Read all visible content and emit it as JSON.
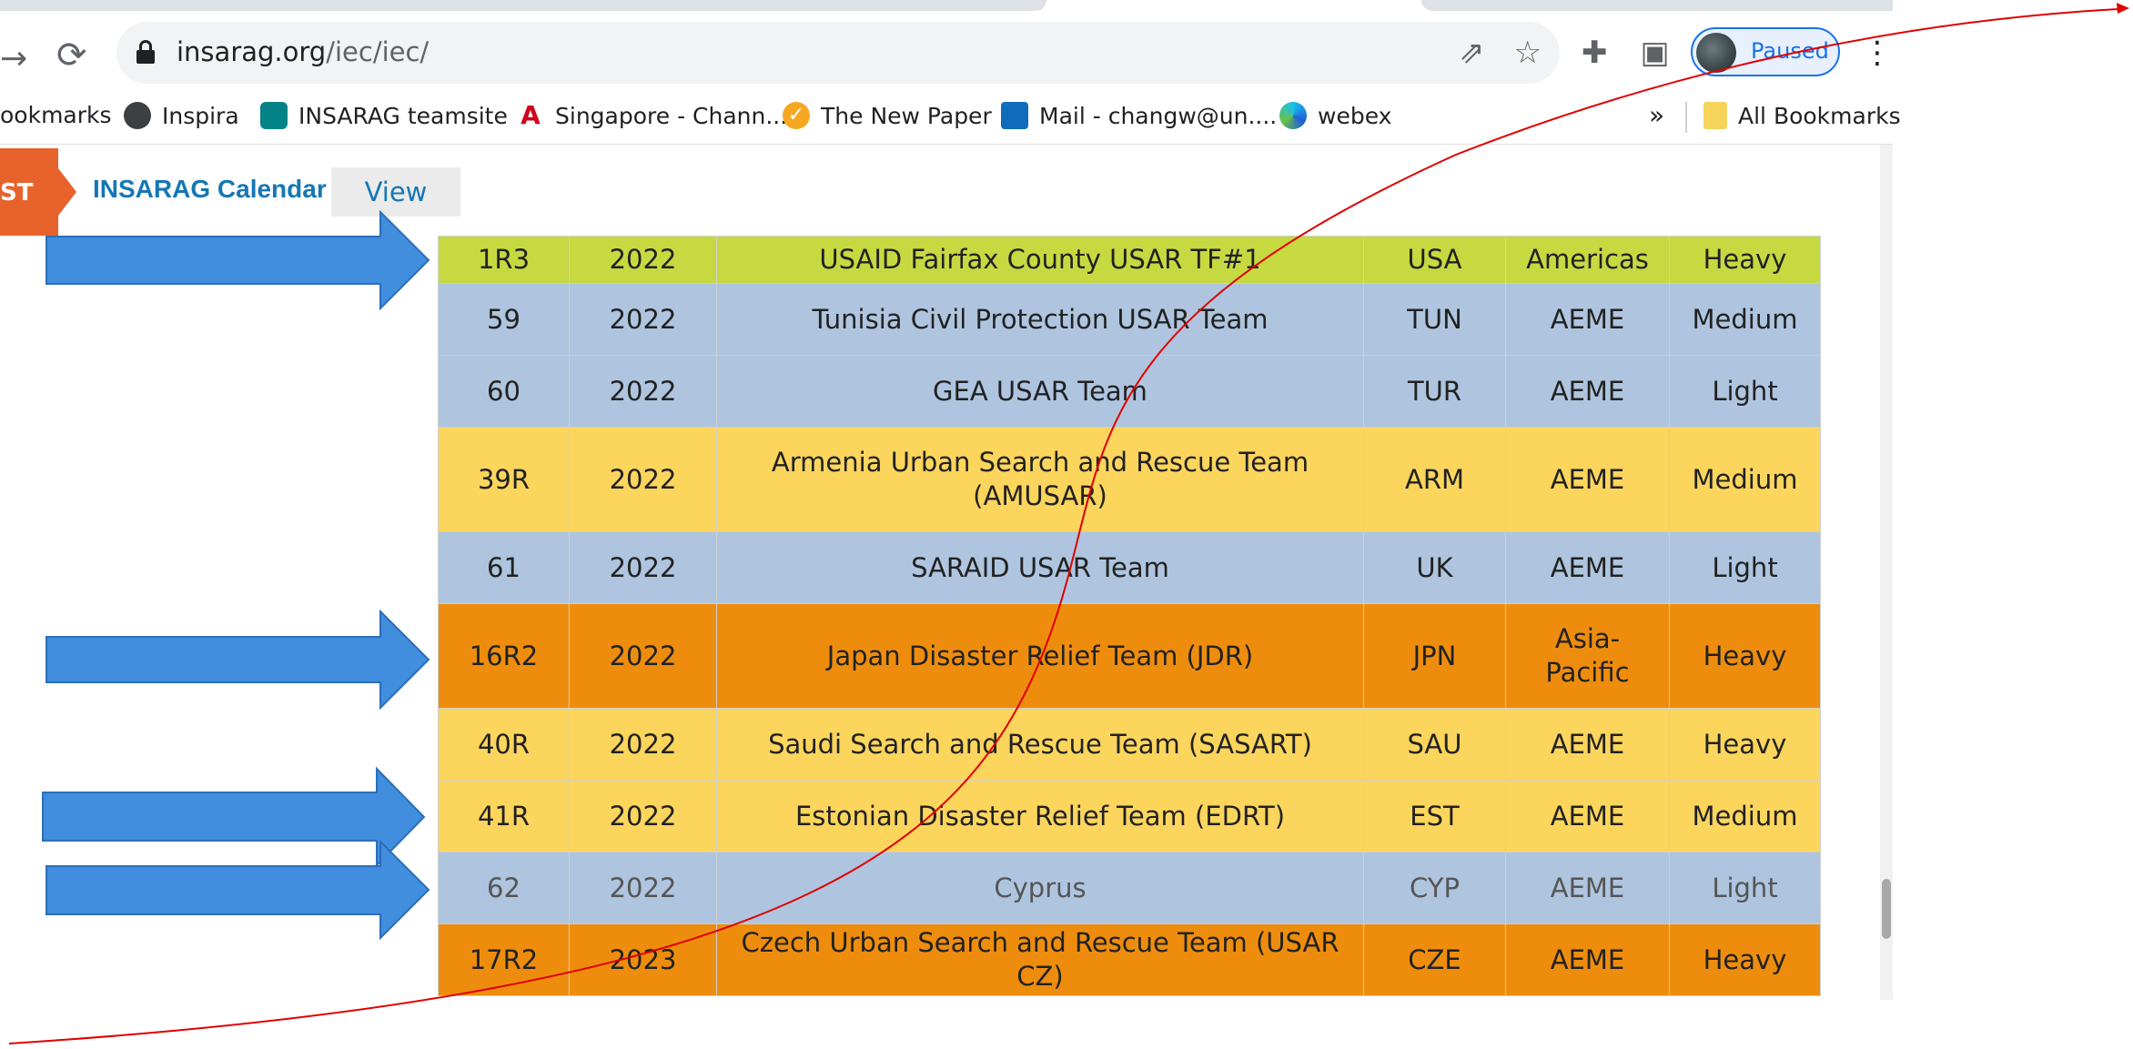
{
  "browser": {
    "url_host": "insarag.org",
    "url_path": "/iec/iec/",
    "profile_status": "Paused",
    "icons": [
      "forward-icon",
      "reload-icon",
      "lock-icon",
      "share-icon",
      "star-icon",
      "extensions-icon",
      "side-panel-icon",
      "menu-icon"
    ]
  },
  "bookmarks": {
    "items": [
      {
        "label": "ookmarks"
      },
      {
        "label": "Inspira"
      },
      {
        "label": "INSARAG teamsite"
      },
      {
        "label": "Singapore - Chann..."
      },
      {
        "label": "The New Paper"
      },
      {
        "label": "Mail - changw@un...."
      },
      {
        "label": "webex"
      }
    ],
    "more": "»",
    "all_bookmarks": "All Bookmarks"
  },
  "page": {
    "tag": "ST",
    "calendar_title": "INSARAG Calendar",
    "view_label": "View"
  },
  "table": {
    "rows": [
      {
        "id": "1R3",
        "year": "2022",
        "team": "USAID Fairfax County USAR TF#1",
        "country": "USA",
        "region": "Americas",
        "level": "Heavy",
        "color": "green"
      },
      {
        "id": "59",
        "year": "2022",
        "team": "Tunisia Civil Protection USAR Team",
        "country": "TUN",
        "region": "AEME",
        "level": "Medium",
        "color": "blue"
      },
      {
        "id": "60",
        "year": "2022",
        "team": "GEA USAR Team",
        "country": "TUR",
        "region": "AEME",
        "level": "Light",
        "color": "blue"
      },
      {
        "id": "39R",
        "year": "2022",
        "team": "Armenia Urban Search and Rescue Team (AMUSAR)",
        "country": "ARM",
        "region": "AEME",
        "level": "Medium",
        "color": "yellow"
      },
      {
        "id": "61",
        "year": "2022",
        "team": "SARAID USAR Team",
        "country": "UK",
        "region": "AEME",
        "level": "Light",
        "color": "blue"
      },
      {
        "id": "16R2",
        "year": "2022",
        "team": "Japan Disaster Relief Team (JDR)",
        "country": "JPN",
        "region": "Asia-Pacific",
        "level": "Heavy",
        "color": "orange"
      },
      {
        "id": "40R",
        "year": "2022",
        "team": "Saudi Search and Rescue Team (SASART)",
        "country": "SAU",
        "region": "AEME",
        "level": "Heavy",
        "color": "yellow"
      },
      {
        "id": "41R",
        "year": "2022",
        "team": "Estonian Disaster Relief Team (EDRT)",
        "country": "EST",
        "region": "AEME",
        "level": "Medium",
        "color": "yellow"
      },
      {
        "id": "62",
        "year": "2022",
        "team": "Cyprus",
        "country": "CYP",
        "region": "AEME",
        "level": "Light",
        "color": "blue"
      },
      {
        "id": "17R2",
        "year": "2023",
        "team": "Czech Urban Search and Rescue Team (USAR CZ)",
        "country": "CZE",
        "region": "AEME",
        "level": "Heavy",
        "color": "orange"
      }
    ]
  },
  "colors": {
    "green": "#c6d941",
    "blue": "#afc5df",
    "yellow": "#fcd55d",
    "orange": "#ee8d0d",
    "arrow": "#418dde",
    "annotation_line": "#e00000"
  }
}
